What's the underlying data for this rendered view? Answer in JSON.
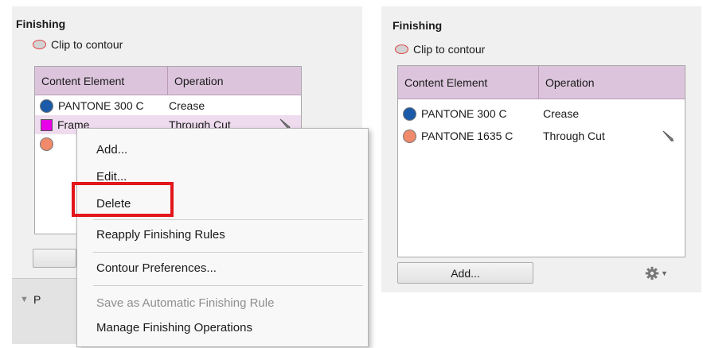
{
  "left": {
    "title": "Finishing",
    "clip_label": "Clip to contour",
    "columns": [
      "Content Element",
      "Operation"
    ],
    "rows": [
      {
        "swatch": "dot",
        "color": "#1a5aa8",
        "element": "PANTONE 300 C",
        "operation": "Crease"
      },
      {
        "swatch": "square",
        "color": "#e800e8",
        "element": "Frame",
        "operation": "Through Cut"
      },
      {
        "swatch": "dot",
        "color": "#f08a6a",
        "element": "",
        "operation": ""
      }
    ],
    "lower_label": "P"
  },
  "context_menu": {
    "items": [
      "Add...",
      "Edit...",
      "Delete",
      "Reapply Finishing Rules",
      "Contour Preferences...",
      "Save as Automatic Finishing Rule",
      "Manage Finishing Operations"
    ],
    "highlighted": "Delete",
    "highlight_color": "#e2161b"
  },
  "right": {
    "title": "Finishing",
    "clip_label": "Clip to contour",
    "columns": [
      "Content Element",
      "Operation"
    ],
    "rows": [
      {
        "swatch": "dot",
        "color": "#1a5aa8",
        "element": "PANTONE 300 C",
        "operation": "Crease"
      },
      {
        "swatch": "dot",
        "color": "#f08a6a",
        "element": "PANTONE 1635 C",
        "operation": "Through Cut"
      }
    ],
    "add_label": "Add..."
  },
  "colors": {
    "header_bg": "#dcc5dc",
    "selected_row": "#eedcee",
    "panel_bg": "#f0f0f0"
  }
}
